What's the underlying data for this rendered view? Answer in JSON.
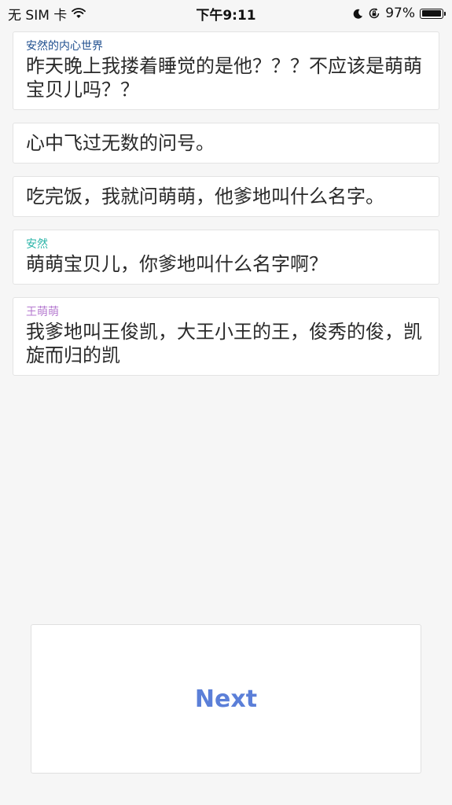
{
  "status_bar": {
    "carrier": "无 SIM 卡",
    "time": "下午9:11",
    "battery": "97%",
    "battery_level": 0.97
  },
  "messages": [
    {
      "speaker": "安然的内心世界",
      "speaker_color": "#1f4f8f",
      "text": "昨天晚上我搂着睡觉的是他？？？不应该是萌萌宝贝儿吗？？"
    },
    {
      "speaker": "",
      "text": "心中飞过无数的问号。"
    },
    {
      "speaker": "",
      "text": "吃完饭，我就问萌萌，他爹地叫什么名字。"
    },
    {
      "speaker": "安然",
      "speaker_color": "#2bb5a8",
      "text": "萌萌宝贝儿，你爹地叫什么名字啊？"
    },
    {
      "speaker": "王萌萌",
      "speaker_color": "#b57ad0",
      "text": "我爹地叫王俊凯，大王小王的王，俊秀的俊，凯旋而归的凯"
    }
  ],
  "next_button": {
    "label": "Next",
    "color": "#5b7fd8"
  },
  "icons": [
    "wifi-icon",
    "moon-icon",
    "orientation-lock-icon",
    "battery-icon"
  ]
}
